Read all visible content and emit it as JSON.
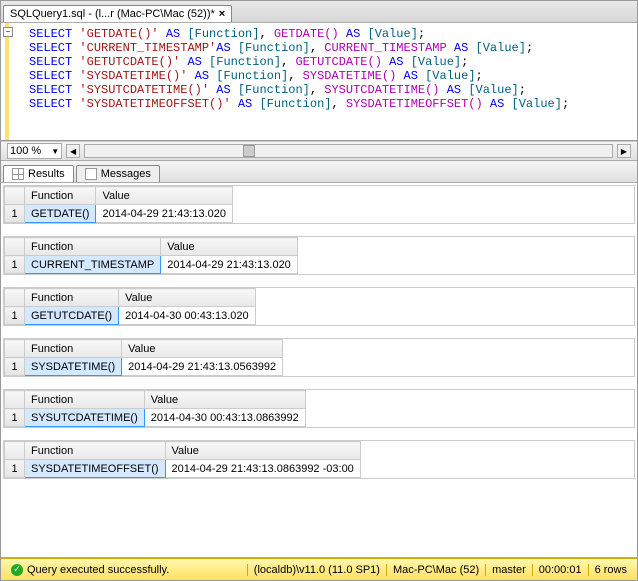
{
  "tab": {
    "title": "SQLQuery1.sql - (l...r (Mac-PC\\Mac (52))*"
  },
  "zoom": "100 %",
  "editor": {
    "lines": [
      {
        "t": [
          {
            "c": "kw",
            "s": "SELECT "
          },
          {
            "c": "str",
            "s": "'GETDATE()' "
          },
          {
            "c": "kw",
            "s": "AS"
          },
          {
            "c": "alias",
            "s": " [Function]"
          },
          {
            "c": "",
            "s": ", "
          },
          {
            "c": "func",
            "s": "GETDATE()"
          },
          {
            "c": "kw",
            "s": " AS "
          },
          {
            "c": "alias",
            "s": "[Value]"
          },
          {
            "c": "",
            "s": ";"
          }
        ]
      },
      {
        "t": [
          {
            "c": "kw",
            "s": "SELECT "
          },
          {
            "c": "str",
            "s": "'CURRENT_TIMESTAMP'"
          },
          {
            "c": "kw",
            "s": "AS"
          },
          {
            "c": "alias",
            "s": " [Function]"
          },
          {
            "c": "",
            "s": ", "
          },
          {
            "c": "func",
            "s": "CURRENT_TIMESTAMP"
          },
          {
            "c": "kw",
            "s": " AS "
          },
          {
            "c": "alias",
            "s": "[Value]"
          },
          {
            "c": "",
            "s": ";"
          }
        ]
      },
      {
        "t": [
          {
            "c": "kw",
            "s": "SELECT "
          },
          {
            "c": "str",
            "s": "'GETUTCDATE()' "
          },
          {
            "c": "kw",
            "s": "AS"
          },
          {
            "c": "alias",
            "s": " [Function]"
          },
          {
            "c": "",
            "s": ", "
          },
          {
            "c": "func",
            "s": "GETUTCDATE()"
          },
          {
            "c": "kw",
            "s": " AS "
          },
          {
            "c": "alias",
            "s": "[Value]"
          },
          {
            "c": "",
            "s": ";"
          }
        ]
      },
      {
        "t": [
          {
            "c": "kw",
            "s": "SELECT "
          },
          {
            "c": "str",
            "s": "'SYSDATETIME()' "
          },
          {
            "c": "kw",
            "s": "AS"
          },
          {
            "c": "alias",
            "s": " [Function]"
          },
          {
            "c": "",
            "s": ", "
          },
          {
            "c": "func",
            "s": "SYSDATETIME()"
          },
          {
            "c": "kw",
            "s": " AS "
          },
          {
            "c": "alias",
            "s": "[Value]"
          },
          {
            "c": "",
            "s": ";"
          }
        ]
      },
      {
        "t": [
          {
            "c": "kw",
            "s": "SELECT "
          },
          {
            "c": "str",
            "s": "'SYSUTCDATETIME()' "
          },
          {
            "c": "kw",
            "s": "AS"
          },
          {
            "c": "alias",
            "s": " [Function]"
          },
          {
            "c": "",
            "s": ", "
          },
          {
            "c": "func",
            "s": "SYSUTCDATETIME()"
          },
          {
            "c": "kw",
            "s": " AS "
          },
          {
            "c": "alias",
            "s": "[Value]"
          },
          {
            "c": "",
            "s": ";"
          }
        ]
      },
      {
        "t": [
          {
            "c": "kw",
            "s": "SELECT "
          },
          {
            "c": "str",
            "s": "'SYSDATETIMEOFFSET()' "
          },
          {
            "c": "kw",
            "s": "AS"
          },
          {
            "c": "alias",
            "s": " [Function]"
          },
          {
            "c": "",
            "s": ", "
          },
          {
            "c": "func",
            "s": "SYSDATETIMEOFFSET()"
          },
          {
            "c": "kw",
            "s": " AS "
          },
          {
            "c": "alias",
            "s": "[Value]"
          },
          {
            "c": "",
            "s": ";"
          }
        ]
      }
    ]
  },
  "resultTabs": {
    "results": "Results",
    "messages": "Messages"
  },
  "gridsData": [
    {
      "cols": [
        "Function",
        "Value"
      ],
      "rows": [
        [
          "GETDATE()",
          "2014-04-29 21:43:13.020"
        ]
      ],
      "selectedCol0": true
    },
    {
      "cols": [
        "Function",
        "Value"
      ],
      "rows": [
        [
          "CURRENT_TIMESTAMP",
          "2014-04-29 21:43:13.020"
        ]
      ],
      "selectedCol0": true
    },
    {
      "cols": [
        "Function",
        "Value"
      ],
      "rows": [
        [
          "GETUTCDATE()",
          "2014-04-30 00:43:13.020"
        ]
      ],
      "selectedCol0": true
    },
    {
      "cols": [
        "Function",
        "Value"
      ],
      "rows": [
        [
          "SYSDATETIME()",
          "2014-04-29 21:43:13.0563992"
        ]
      ],
      "selectedCol0": true
    },
    {
      "cols": [
        "Function",
        "Value"
      ],
      "rows": [
        [
          "SYSUTCDATETIME()",
          "2014-04-30 00:43:13.0863992"
        ]
      ],
      "selectedCol0": true
    },
    {
      "cols": [
        "Function",
        "Value"
      ],
      "rows": [
        [
          "SYSDATETIMEOFFSET()",
          "2014-04-29 21:43:13.0863992 -03:00"
        ]
      ],
      "selectedCol0": true
    }
  ],
  "status": {
    "msg": "Query executed successfully.",
    "server": "(localdb)\\v11.0 (11.0 SP1)",
    "login": "Mac-PC\\Mac (52)",
    "db": "master",
    "elapsed": "00:00:01",
    "rows": "6 rows"
  }
}
